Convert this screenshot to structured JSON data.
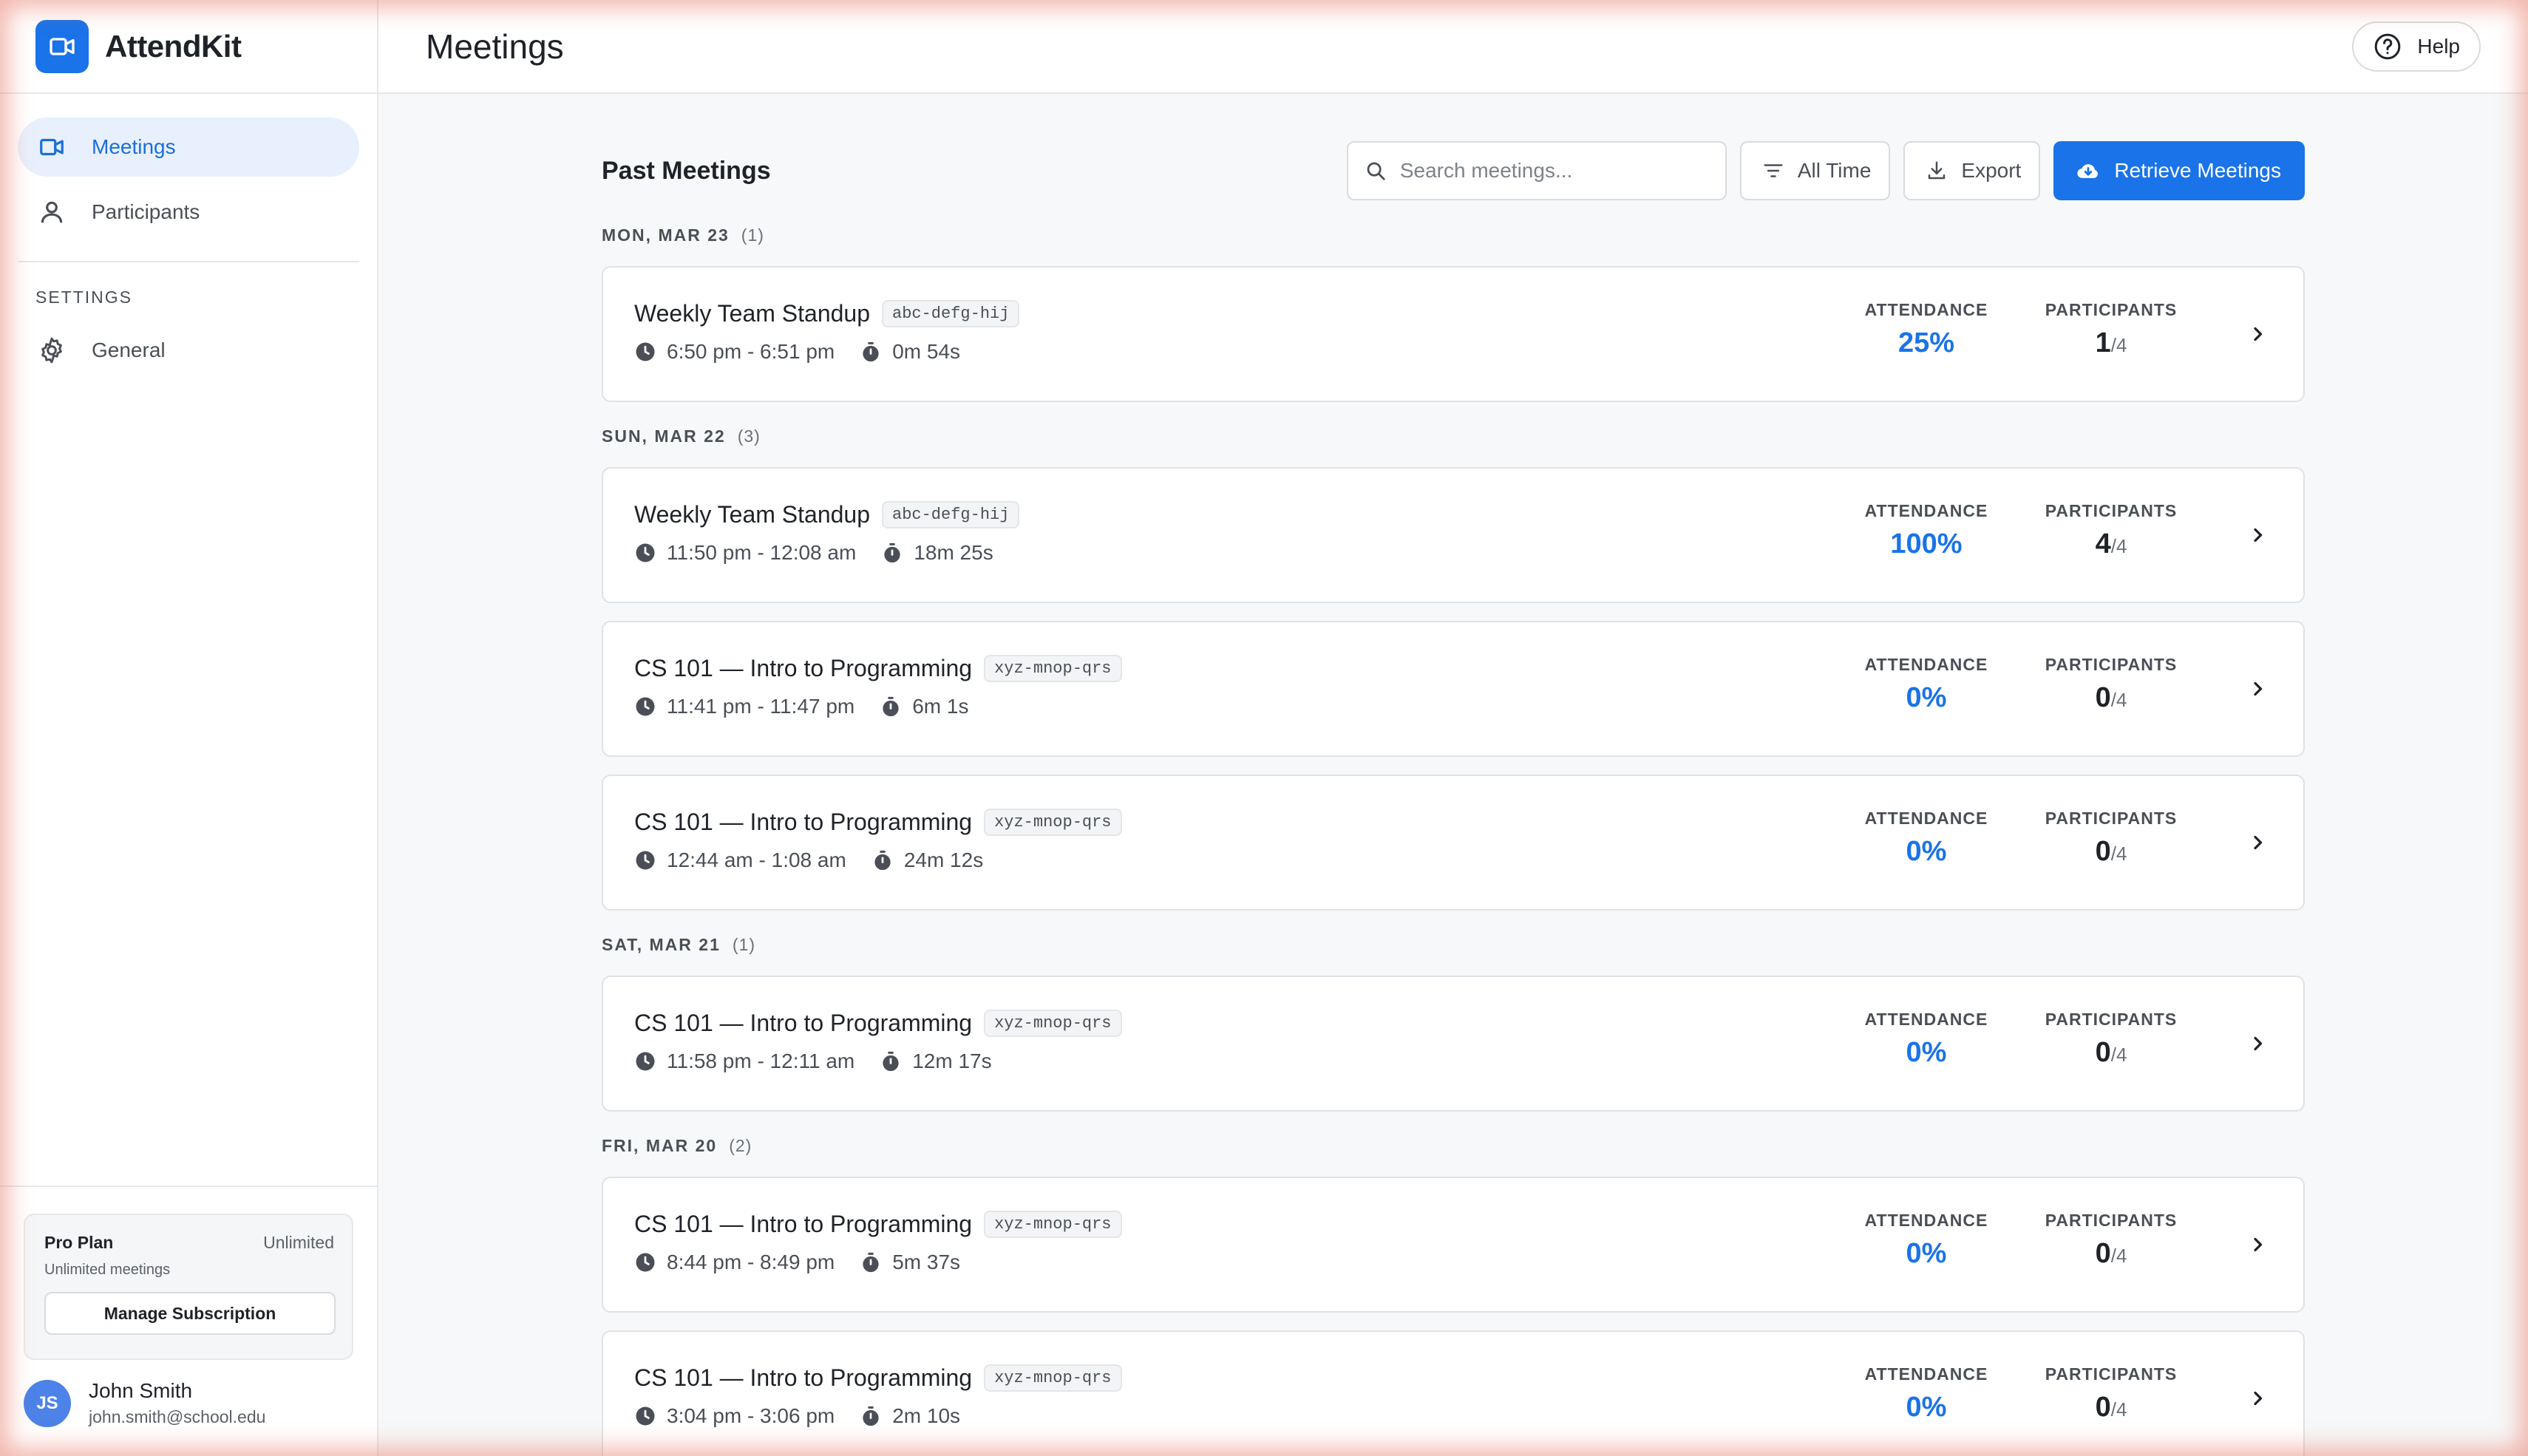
{
  "app": {
    "name": "AttendKit"
  },
  "nav": {
    "items": [
      {
        "label": "Meetings",
        "icon": "video-camera-icon",
        "active": true
      },
      {
        "label": "Participants",
        "icon": "person-icon",
        "active": false
      }
    ],
    "settings_label": "SETTINGS",
    "settings_items": [
      {
        "label": "General",
        "icon": "gear-icon"
      }
    ]
  },
  "plan": {
    "name": "Pro Plan",
    "limit": "Unlimited",
    "description": "Unlimited meetings",
    "manage_label": "Manage Subscription"
  },
  "user": {
    "initials": "JS",
    "name": "John Smith",
    "email": "john.smith@school.edu"
  },
  "header": {
    "title": "Meetings",
    "help_label": "Help"
  },
  "toolbar": {
    "section_title": "Past Meetings",
    "search_placeholder": "Search meetings...",
    "filter_label": "All Time",
    "export_label": "Export",
    "retrieve_label": "Retrieve Meetings"
  },
  "labels": {
    "attendance": "ATTENDANCE",
    "participants": "PARTICIPANTS"
  },
  "colors": {
    "accent": "#1a73e8",
    "active_nav_bg": "#e8f0fd"
  },
  "groups": [
    {
      "date": "MON, MAR 23",
      "count": "(1)",
      "meetings": [
        {
          "title": "Weekly Team Standup",
          "code": "abc-defg-hij",
          "time": "6:50 pm - 6:51 pm",
          "duration": "0m 54s",
          "attendance": "25%",
          "participants_current": "1",
          "participants_total": "/4"
        }
      ]
    },
    {
      "date": "SUN, MAR 22",
      "count": "(3)",
      "meetings": [
        {
          "title": "Weekly Team Standup",
          "code": "abc-defg-hij",
          "time": "11:50 pm - 12:08 am",
          "duration": "18m 25s",
          "attendance": "100%",
          "participants_current": "4",
          "participants_total": "/4"
        },
        {
          "title": "CS 101 — Intro to Programming",
          "code": "xyz-mnop-qrs",
          "time": "11:41 pm - 11:47 pm",
          "duration": "6m 1s",
          "attendance": "0%",
          "participants_current": "0",
          "participants_total": "/4"
        },
        {
          "title": "CS 101 — Intro to Programming",
          "code": "xyz-mnop-qrs",
          "time": "12:44 am - 1:08 am",
          "duration": "24m 12s",
          "attendance": "0%",
          "participants_current": "0",
          "participants_total": "/4"
        }
      ]
    },
    {
      "date": "SAT, MAR 21",
      "count": "(1)",
      "meetings": [
        {
          "title": "CS 101 — Intro to Programming",
          "code": "xyz-mnop-qrs",
          "time": "11:58 pm - 12:11 am",
          "duration": "12m 17s",
          "attendance": "0%",
          "participants_current": "0",
          "participants_total": "/4"
        }
      ]
    },
    {
      "date": "FRI, MAR 20",
      "count": "(2)",
      "meetings": [
        {
          "title": "CS 101 — Intro to Programming",
          "code": "xyz-mnop-qrs",
          "time": "8:44 pm - 8:49 pm",
          "duration": "5m 37s",
          "attendance": "0%",
          "participants_current": "0",
          "participants_total": "/4"
        },
        {
          "title": "CS 101 — Intro to Programming",
          "code": "xyz-mnop-qrs",
          "time": "3:04 pm - 3:06 pm",
          "duration": "2m 10s",
          "attendance": "0%",
          "participants_current": "0",
          "participants_total": "/4"
        }
      ]
    }
  ]
}
